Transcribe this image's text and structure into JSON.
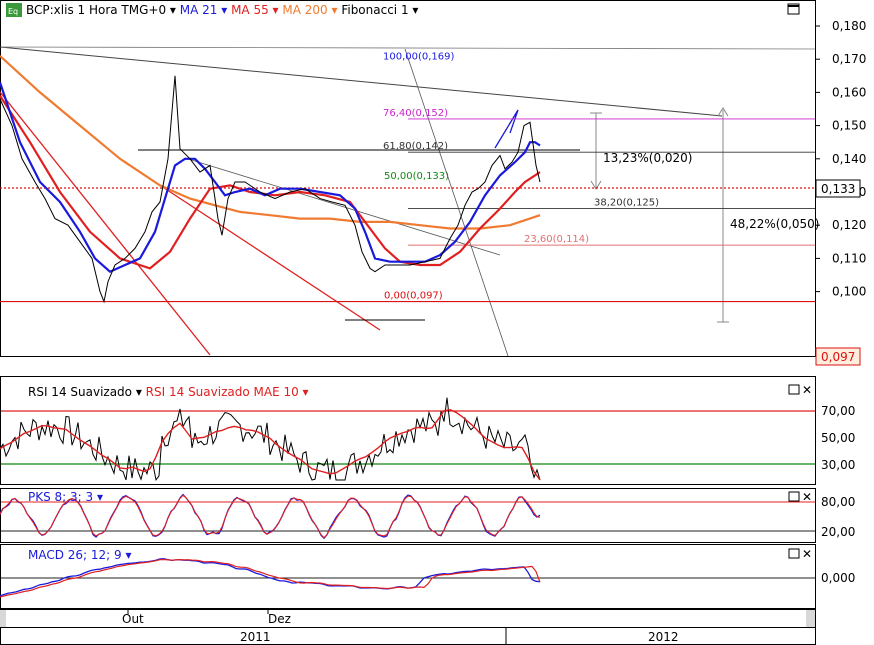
{
  "main_panel": {
    "icon_label": "Eq",
    "legend": [
      {
        "label": "BCP:xlis 1 Hora TMG+0",
        "color": "#000000"
      },
      {
        "label": "MA 21",
        "color": "#1a1adc"
      },
      {
        "label": "MA 55",
        "color": "#e02020"
      },
      {
        "label": "MA 200",
        "color": "#f07a30"
      },
      {
        "label": "Fibonacci 1",
        "color": "#000000"
      }
    ],
    "y_ticks": [
      "0,180",
      "0,170",
      "0,160",
      "0,150",
      "0,140",
      "0,130",
      "0,120",
      "0,110",
      "0,100"
    ],
    "price_tag_last": "0,133",
    "price_tag_low": "0,097",
    "fib_levels": [
      {
        "label": "100,00(0,169)",
        "price": 0.169,
        "color": "#1a1adc"
      },
      {
        "label": "76,40(0,152)",
        "price": 0.152,
        "color": "#cc22cc"
      },
      {
        "label": "61,80(0,142)",
        "price": 0.142,
        "color": "#333333"
      },
      {
        "label": "50,00(0,133)",
        "price": 0.133,
        "color": "#118811"
      },
      {
        "label": "38,20(0,125)",
        "price": 0.125,
        "color": "#333333"
      },
      {
        "label": "23,60(0,114)",
        "price": 0.114,
        "color": "#e07070"
      },
      {
        "label": "0,00(0,097)",
        "price": 0.097,
        "color": "#dd1111"
      }
    ],
    "measure_labels": {
      "short": "13,23%(0,020)",
      "long": "48,22%(0,050)"
    }
  },
  "rsi_panel": {
    "legend": [
      {
        "label": "RSI 14 Suavizado",
        "color": "#000000"
      },
      {
        "label": "RSI 14 Suavizado MAE 10",
        "color": "#e02020"
      }
    ],
    "y_ticks": [
      "70,00",
      "50,00",
      "30,00"
    ]
  },
  "pks_panel": {
    "legend": [
      {
        "label": "PKS 8; 3; 3",
        "color": "#1a1adc"
      }
    ],
    "y_ticks": [
      "80,00",
      "20,00"
    ]
  },
  "macd_panel": {
    "legend": [
      {
        "label": "MACD 26; 12; 9",
        "color": "#1a1adc"
      }
    ],
    "y_ticks": [
      "0,000"
    ]
  },
  "x_axis": {
    "months": [
      "Out",
      "Dez"
    ],
    "years": [
      "2011",
      "2012"
    ]
  },
  "chart_data": {
    "type": "line",
    "title": "BCP:xlis 1 Hora TMG+0",
    "ylim": [
      0.095,
      0.184
    ],
    "series": [
      {
        "name": "BCP:xlis 1 Hora TMG+0",
        "x": [
          0,
          12,
          22,
          35,
          45,
          55,
          68,
          80,
          92,
          100,
          104,
          108,
          115,
          125,
          135,
          145,
          152,
          160,
          168,
          175,
          180,
          190,
          200,
          210,
          218,
          222,
          228,
          235,
          245,
          260,
          275,
          290,
          305,
          320,
          332,
          345,
          355,
          362,
          370,
          375,
          385,
          395,
          410,
          425,
          440,
          450,
          458,
          465,
          472,
          478,
          485,
          492,
          500,
          505,
          512,
          518,
          524,
          530,
          536,
          540
        ],
        "values": [
          0.158,
          0.15,
          0.14,
          0.133,
          0.128,
          0.122,
          0.12,
          0.115,
          0.11,
          0.1,
          0.097,
          0.103,
          0.108,
          0.11,
          0.113,
          0.118,
          0.124,
          0.127,
          0.14,
          0.165,
          0.143,
          0.14,
          0.136,
          0.138,
          0.122,
          0.117,
          0.128,
          0.133,
          0.133,
          0.13,
          0.128,
          0.13,
          0.131,
          0.128,
          0.127,
          0.126,
          0.12,
          0.112,
          0.107,
          0.106,
          0.108,
          0.108,
          0.108,
          0.109,
          0.11,
          0.116,
          0.12,
          0.126,
          0.13,
          0.131,
          0.133,
          0.138,
          0.141,
          0.137,
          0.139,
          0.142,
          0.15,
          0.151,
          0.138,
          0.133
        ]
      },
      {
        "name": "MA 21",
        "x": [
          0,
          20,
          40,
          60,
          80,
          95,
          110,
          125,
          140,
          155,
          165,
          175,
          185,
          195,
          205,
          215,
          225,
          235,
          250,
          265,
          280,
          300,
          320,
          340,
          355,
          365,
          375,
          390,
          410,
          425,
          440,
          455,
          470,
          485,
          500,
          515,
          525,
          530,
          535,
          540
        ],
        "values": [
          0.163,
          0.145,
          0.133,
          0.127,
          0.118,
          0.11,
          0.106,
          0.108,
          0.11,
          0.118,
          0.128,
          0.138,
          0.14,
          0.14,
          0.137,
          0.133,
          0.129,
          0.13,
          0.131,
          0.129,
          0.131,
          0.131,
          0.13,
          0.129,
          0.125,
          0.118,
          0.11,
          0.109,
          0.109,
          0.109,
          0.111,
          0.115,
          0.121,
          0.129,
          0.135,
          0.139,
          0.142,
          0.145,
          0.145,
          0.144
        ]
      },
      {
        "name": "MA 55",
        "x": [
          0,
          30,
          60,
          90,
          120,
          150,
          170,
          190,
          210,
          230,
          250,
          275,
          300,
          325,
          350,
          370,
          385,
          400,
          420,
          440,
          460,
          480,
          500,
          515,
          525,
          535,
          540
        ],
        "values": [
          0.159,
          0.145,
          0.13,
          0.118,
          0.11,
          0.107,
          0.112,
          0.122,
          0.131,
          0.132,
          0.13,
          0.129,
          0.13,
          0.129,
          0.127,
          0.119,
          0.113,
          0.109,
          0.108,
          0.108,
          0.112,
          0.119,
          0.125,
          0.13,
          0.133,
          0.135,
          0.136
        ]
      },
      {
        "name": "MA 200",
        "x": [
          0,
          40,
          80,
          120,
          160,
          190,
          215,
          240,
          270,
          300,
          330,
          360,
          390,
          420,
          450,
          480,
          510,
          540
        ],
        "values": [
          0.171,
          0.16,
          0.15,
          0.14,
          0.132,
          0.128,
          0.126,
          0.124,
          0.123,
          0.122,
          0.122,
          0.121,
          0.121,
          0.12,
          0.119,
          0.119,
          0.12,
          0.123
        ]
      }
    ]
  }
}
